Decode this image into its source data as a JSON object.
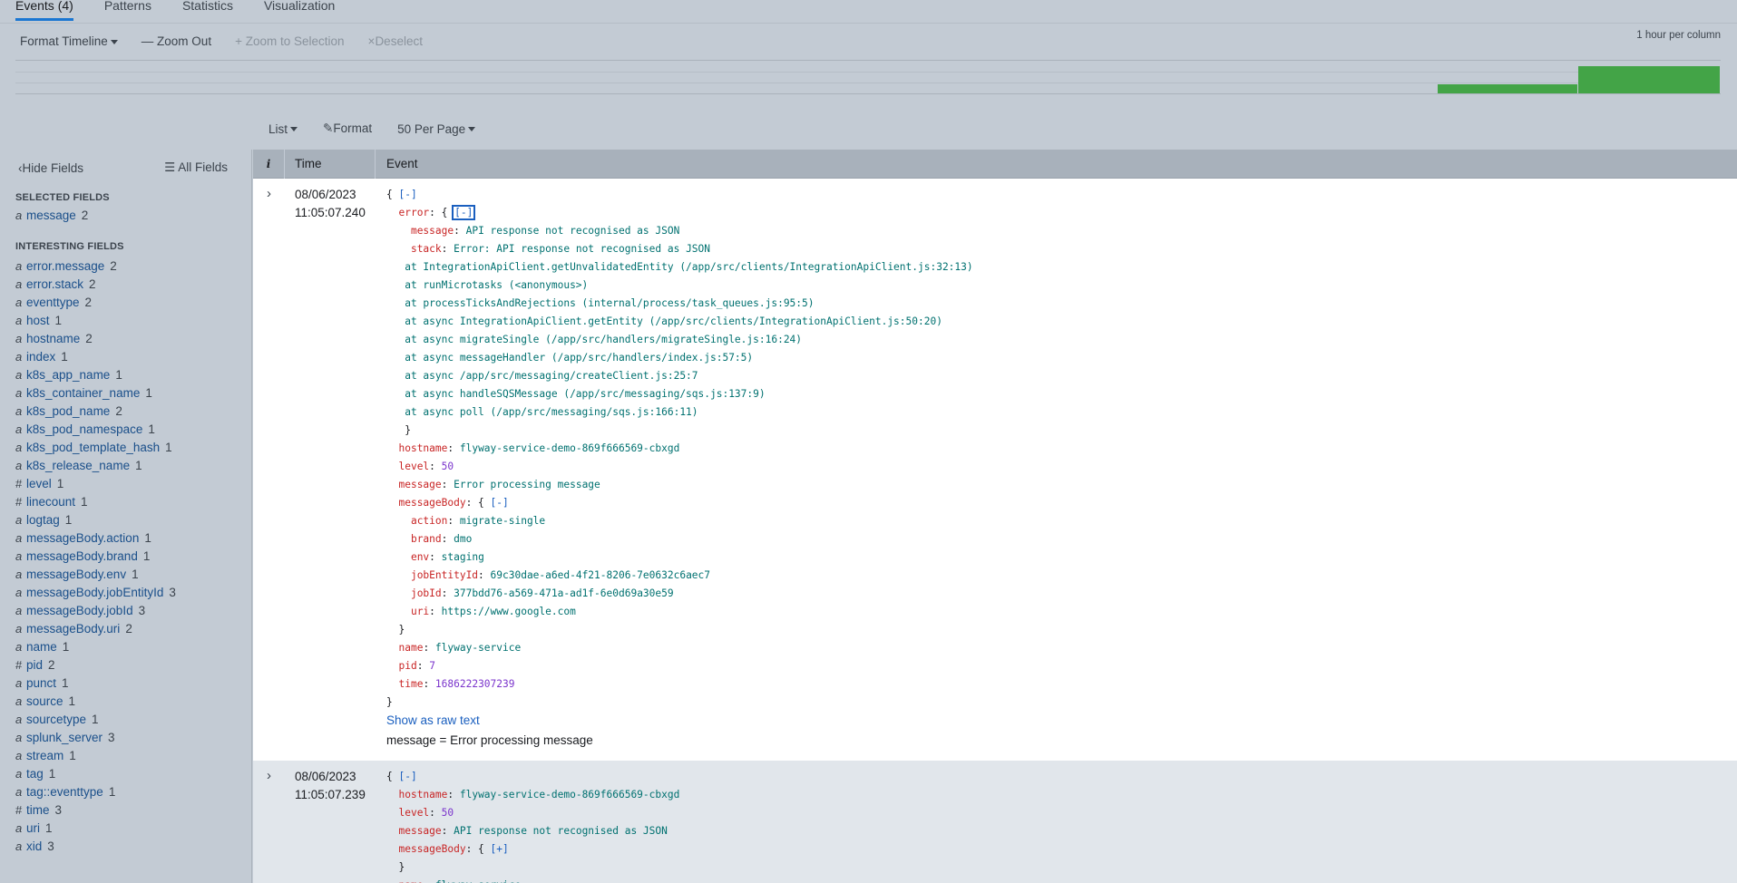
{
  "tabs": [
    {
      "label": "Events (4)",
      "active": true
    },
    {
      "label": "Patterns",
      "active": false
    },
    {
      "label": "Statistics",
      "active": false
    },
    {
      "label": "Visualization",
      "active": false
    }
  ],
  "timeline_toolbar": {
    "format_timeline": "Format Timeline",
    "zoom_out": "Zoom Out",
    "zoom_to_selection": "Zoom to Selection",
    "deselect": "Deselect",
    "scale": "1 hour per column"
  },
  "timeline": {
    "bar_color": "#43a447",
    "columns": [
      {
        "level": 0
      },
      {
        "level": 0.35
      },
      {
        "level": 1
      }
    ]
  },
  "results_toolbar": {
    "list": "List",
    "format": "Format",
    "per_page": "50 Per Page"
  },
  "sidebar": {
    "hide_fields": "Hide Fields",
    "all_fields": "All Fields",
    "selected_title": "SELECTED FIELDS",
    "selected": [
      {
        "type": "a",
        "name": "message",
        "count": "2"
      }
    ],
    "interesting_title": "INTERESTING FIELDS",
    "interesting": [
      {
        "type": "a",
        "name": "error.message",
        "count": "2"
      },
      {
        "type": "a",
        "name": "error.stack",
        "count": "2"
      },
      {
        "type": "a",
        "name": "eventtype",
        "count": "2"
      },
      {
        "type": "a",
        "name": "host",
        "count": "1"
      },
      {
        "type": "a",
        "name": "hostname",
        "count": "2"
      },
      {
        "type": "a",
        "name": "index",
        "count": "1"
      },
      {
        "type": "a",
        "name": "k8s_app_name",
        "count": "1"
      },
      {
        "type": "a",
        "name": "k8s_container_name",
        "count": "1"
      },
      {
        "type": "a",
        "name": "k8s_pod_name",
        "count": "2"
      },
      {
        "type": "a",
        "name": "k8s_pod_namespace",
        "count": "1"
      },
      {
        "type": "a",
        "name": "k8s_pod_template_hash",
        "count": "1"
      },
      {
        "type": "a",
        "name": "k8s_release_name",
        "count": "1"
      },
      {
        "type": "#",
        "name": "level",
        "count": "1"
      },
      {
        "type": "#",
        "name": "linecount",
        "count": "1"
      },
      {
        "type": "a",
        "name": "logtag",
        "count": "1"
      },
      {
        "type": "a",
        "name": "messageBody.action",
        "count": "1"
      },
      {
        "type": "a",
        "name": "messageBody.brand",
        "count": "1"
      },
      {
        "type": "a",
        "name": "messageBody.env",
        "count": "1"
      },
      {
        "type": "a",
        "name": "messageBody.jobEntityId",
        "count": "3"
      },
      {
        "type": "a",
        "name": "messageBody.jobId",
        "count": "3"
      },
      {
        "type": "a",
        "name": "messageBody.uri",
        "count": "2"
      },
      {
        "type": "a",
        "name": "name",
        "count": "1"
      },
      {
        "type": "#",
        "name": "pid",
        "count": "2"
      },
      {
        "type": "a",
        "name": "punct",
        "count": "1"
      },
      {
        "type": "a",
        "name": "source",
        "count": "1"
      },
      {
        "type": "a",
        "name": "sourcetype",
        "count": "1"
      },
      {
        "type": "a",
        "name": "splunk_server",
        "count": "3"
      },
      {
        "type": "a",
        "name": "stream",
        "count": "1"
      },
      {
        "type": "a",
        "name": "tag",
        "count": "1"
      },
      {
        "type": "a",
        "name": "tag::eventtype",
        "count": "1"
      },
      {
        "type": "#",
        "name": "time",
        "count": "3"
      },
      {
        "type": "a",
        "name": "uri",
        "count": "1"
      },
      {
        "type": "a",
        "name": "xid",
        "count": "3"
      }
    ]
  },
  "table": {
    "col_info": "i",
    "col_time": "Time",
    "col_event": "Event"
  },
  "events": [
    {
      "date": "08/06/2023",
      "time": "11:05:07.240",
      "lines": [
        [
          [
            "{ ",
            ""
          ],
          [
            "[-]",
            "b"
          ]
        ],
        [
          [
            "  ",
            ""
          ],
          [
            "error",
            "k"
          ],
          [
            ": { ",
            ""
          ],
          [
            "[-]",
            "bf"
          ]
        ],
        [
          [
            "    ",
            ""
          ],
          [
            "message",
            "k"
          ],
          [
            ": ",
            ""
          ],
          [
            "API response not recognised as JSON",
            "s"
          ]
        ],
        [
          [
            "    ",
            ""
          ],
          [
            "stack",
            "k"
          ],
          [
            ": ",
            ""
          ],
          [
            "Error: API response not recognised as JSON",
            "s"
          ]
        ],
        [
          [
            "   ",
            ""
          ],
          [
            "at IntegrationApiClient.getUnvalidatedEntity (/app/src/clients/IntegrationApiClient.js:32:13)",
            "s"
          ]
        ],
        [
          [
            "   ",
            ""
          ],
          [
            "at runMicrotasks (<anonymous>)",
            "s"
          ]
        ],
        [
          [
            "   ",
            ""
          ],
          [
            "at processTicksAndRejections (internal/process/task_queues.js:95:5)",
            "s"
          ]
        ],
        [
          [
            "   ",
            ""
          ],
          [
            "at async IntegrationApiClient.getEntity (/app/src/clients/IntegrationApiClient.js:50:20)",
            "s"
          ]
        ],
        [
          [
            "   ",
            ""
          ],
          [
            "at async migrateSingle (/app/src/handlers/migrateSingle.js:16:24)",
            "s"
          ]
        ],
        [
          [
            "   ",
            ""
          ],
          [
            "at async messageHandler (/app/src/handlers/index.js:57:5)",
            "s"
          ]
        ],
        [
          [
            "   ",
            ""
          ],
          [
            "at async /app/src/messaging/createClient.js:25:7",
            "s"
          ]
        ],
        [
          [
            "   ",
            ""
          ],
          [
            "at async handleSQSMessage (/app/src/messaging/sqs.js:137:9)",
            "s"
          ]
        ],
        [
          [
            "   ",
            ""
          ],
          [
            "at async poll (/app/src/messaging/sqs.js:166:11)",
            "s"
          ]
        ],
        [
          [
            "   }",
            ""
          ]
        ],
        [
          [
            "  ",
            ""
          ],
          [
            "hostname",
            "k"
          ],
          [
            ": ",
            ""
          ],
          [
            "flyway-service-demo-869f666569-cbxgd",
            "s"
          ]
        ],
        [
          [
            "  ",
            ""
          ],
          [
            "level",
            "k"
          ],
          [
            ": ",
            ""
          ],
          [
            "50",
            "n"
          ]
        ],
        [
          [
            "  ",
            ""
          ],
          [
            "message",
            "k"
          ],
          [
            ": ",
            ""
          ],
          [
            "Error processing message",
            "s"
          ]
        ],
        [
          [
            "  ",
            ""
          ],
          [
            "messageBody",
            "k"
          ],
          [
            ": { ",
            ""
          ],
          [
            "[-]",
            "b"
          ]
        ],
        [
          [
            "    ",
            ""
          ],
          [
            "action",
            "k"
          ],
          [
            ": ",
            ""
          ],
          [
            "migrate-single",
            "s"
          ]
        ],
        [
          [
            "    ",
            ""
          ],
          [
            "brand",
            "k"
          ],
          [
            ": ",
            ""
          ],
          [
            "dmo",
            "s"
          ]
        ],
        [
          [
            "    ",
            ""
          ],
          [
            "env",
            "k"
          ],
          [
            ": ",
            ""
          ],
          [
            "staging",
            "s"
          ]
        ],
        [
          [
            "    ",
            ""
          ],
          [
            "jobEntityId",
            "k"
          ],
          [
            ": ",
            ""
          ],
          [
            "69c30dae-a6ed-4f21-8206-7e0632c6aec7",
            "s"
          ]
        ],
        [
          [
            "    ",
            ""
          ],
          [
            "jobId",
            "k"
          ],
          [
            ": ",
            ""
          ],
          [
            "377bdd76-a569-471a-ad1f-6e0d69a30e59",
            "s"
          ]
        ],
        [
          [
            "    ",
            ""
          ],
          [
            "uri",
            "k"
          ],
          [
            ": ",
            ""
          ],
          [
            "https://www.google.com",
            "s"
          ]
        ],
        [
          [
            "  }",
            ""
          ]
        ],
        [
          [
            "  ",
            ""
          ],
          [
            "name",
            "k"
          ],
          [
            ": ",
            ""
          ],
          [
            "flyway-service",
            "s"
          ]
        ],
        [
          [
            "  ",
            ""
          ],
          [
            "pid",
            "k"
          ],
          [
            ": ",
            ""
          ],
          [
            "7",
            "n"
          ]
        ],
        [
          [
            "  ",
            ""
          ],
          [
            "time",
            "k"
          ],
          [
            ": ",
            ""
          ],
          [
            "1686222307239",
            "n"
          ]
        ],
        [
          [
            "}",
            ""
          ]
        ]
      ],
      "raw_link": "Show as raw text",
      "selected_field": "message = Error processing message"
    },
    {
      "date": "08/06/2023",
      "time": "11:05:07.239",
      "lines": [
        [
          [
            "{ ",
            ""
          ],
          [
            "[-]",
            "b"
          ]
        ],
        [
          [
            "  ",
            ""
          ],
          [
            "hostname",
            "k"
          ],
          [
            ": ",
            ""
          ],
          [
            "flyway-service-demo-869f666569-cbxgd",
            "s"
          ]
        ],
        [
          [
            "  ",
            ""
          ],
          [
            "level",
            "k"
          ],
          [
            ": ",
            ""
          ],
          [
            "50",
            "n"
          ]
        ],
        [
          [
            "  ",
            ""
          ],
          [
            "message",
            "k"
          ],
          [
            ": ",
            ""
          ],
          [
            "API response not recognised as JSON",
            "s"
          ]
        ],
        [
          [
            "  ",
            ""
          ],
          [
            "messageBody",
            "k"
          ],
          [
            ": { ",
            ""
          ],
          [
            "[+]",
            "b"
          ]
        ],
        [
          [
            "  }",
            ""
          ]
        ],
        [
          [
            "  ",
            ""
          ],
          [
            "name",
            "k"
          ],
          [
            ": ",
            ""
          ],
          [
            "flyway-service",
            "s"
          ]
        ]
      ]
    }
  ]
}
